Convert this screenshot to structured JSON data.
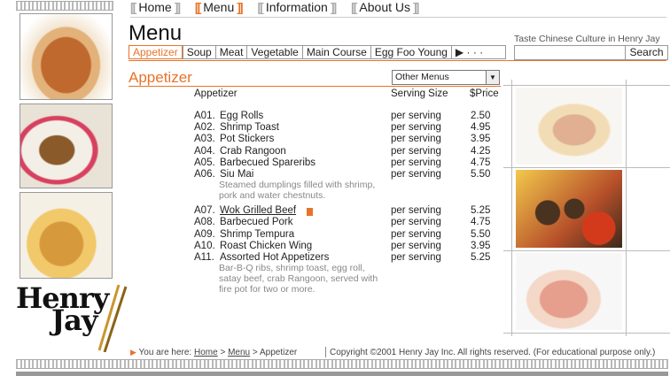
{
  "nav": [
    "Home",
    "Menu",
    "Information",
    "About Us"
  ],
  "nav_active": "Menu",
  "page_title": "Menu",
  "tagline": "Taste Chinese Culture in Henry Jay",
  "tabs": [
    "Appetizer",
    "Soup",
    "Meat",
    "Vegetable",
    "Main Course",
    "Egg Foo Young"
  ],
  "tabs_more": "▶ · · ·",
  "active_tab": "Appetizer",
  "search_label": "Search",
  "section_title": "Appetizer",
  "dropdown_value": "Other Menus",
  "columns": {
    "name": "Appetizer",
    "size": "Serving Size",
    "price": "$Price"
  },
  "items": [
    {
      "code": "A01.",
      "name": "Egg Rolls",
      "size": "per serving",
      "price": "2.50"
    },
    {
      "code": "A02.",
      "name": "Shrimp Toast",
      "size": "per serving",
      "price": "4.95"
    },
    {
      "code": "A03.",
      "name": "Pot Stickers",
      "size": "per serving",
      "price": "3.95"
    },
    {
      "code": "A04.",
      "name": "Crab Rangoon",
      "size": "per serving",
      "price": "4.25"
    },
    {
      "code": "A05.",
      "name": "Barbecued Spareribs",
      "size": "per serving",
      "price": "4.75"
    },
    {
      "code": "A06.",
      "name": "Siu Mai",
      "size": "per serving",
      "price": "5.50",
      "desc": "Steamed dumplings filled with shrimp, pork and water chestnuts."
    },
    {
      "code": "A07.",
      "name": "Wok Grilled Beef",
      "size": "per serving",
      "price": "5.25"
    },
    {
      "code": "A08.",
      "name": "Barbecued Pork",
      "size": "per serving",
      "price": "4.75"
    },
    {
      "code": "A09.",
      "name": "Shrimp Tempura",
      "size": "per serving",
      "price": "5.50"
    },
    {
      "code": "A10.",
      "name": "Roast Chicken Wing",
      "size": "per serving",
      "price": "3.95"
    },
    {
      "code": "A11.",
      "name": "Assorted Hot Appetizers",
      "size": "per serving",
      "price": "5.25",
      "desc": "Bar-B-Q ribs, shrimp toast, egg roll, satay beef, crab Rangoon, served with fire pot for two or more."
    }
  ],
  "logo": {
    "line1": "Henry",
    "line2": "Jay"
  },
  "breadcrumb": {
    "prefix": "You are here:",
    "home": "Home",
    "sep1": ">",
    "menu": "Menu",
    "sep2": ">",
    "current": "Appetizer"
  },
  "copyright": "Copyright ©2001 Henry Jay Inc. All rights reserved. (For educational purpose only.)",
  "colors": {
    "accent": "#e8732a",
    "border": "#999999"
  }
}
